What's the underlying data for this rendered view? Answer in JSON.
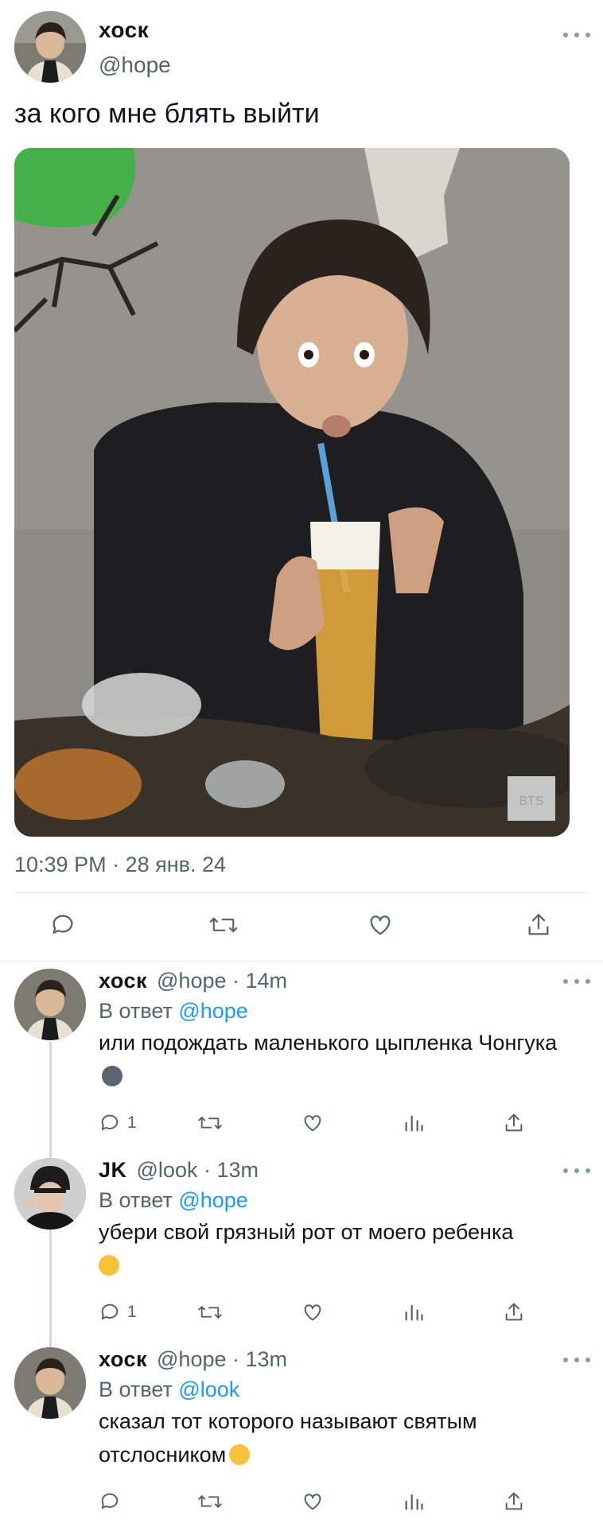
{
  "main_tweet": {
    "display_name": "хоск",
    "handle": "@hope",
    "text": "за кого мне блять выйти",
    "timestamp": "10:39 PM · 28 янв. 24",
    "photo_watermark": "BTS",
    "actions": [
      "reply-icon",
      "retweet-icon",
      "like-icon",
      "share-icon"
    ]
  },
  "replies": [
    {
      "display_name": "хоск",
      "handle": "@hope",
      "age": "· 14m",
      "reply_to_prefix": "В ответ",
      "reply_to": "@hope",
      "text": "или подождать маленького цыпленка Чонгука",
      "emoji": "new-moon-face",
      "reply_count": "1",
      "emoji_color": "#5b6470"
    },
    {
      "display_name": "JK",
      "handle": "@look",
      "age": "· 13m",
      "reply_to_prefix": "В ответ",
      "reply_to": "@hope",
      "text": "убери свой грязный рот от моего ребенка",
      "emoji": "kissing-face-with-closed-eyes",
      "reply_count": "1",
      "emoji_color": "#f7c23a"
    },
    {
      "display_name": "хоск",
      "handle": "@hope",
      "age": "· 13m",
      "reply_to_prefix": "В ответ",
      "reply_to": "@look",
      "text": "сказал тот которого называют святым отслосником",
      "emoji": "smiling-face-with-smiling-eyes",
      "reply_count": "",
      "emoji_color": "#f7c23a"
    }
  ],
  "colors": {
    "link": "#1d9bf0",
    "secondary_text": "#536471",
    "primary_text": "#0f1419",
    "thread_line": "#cfd9de"
  }
}
